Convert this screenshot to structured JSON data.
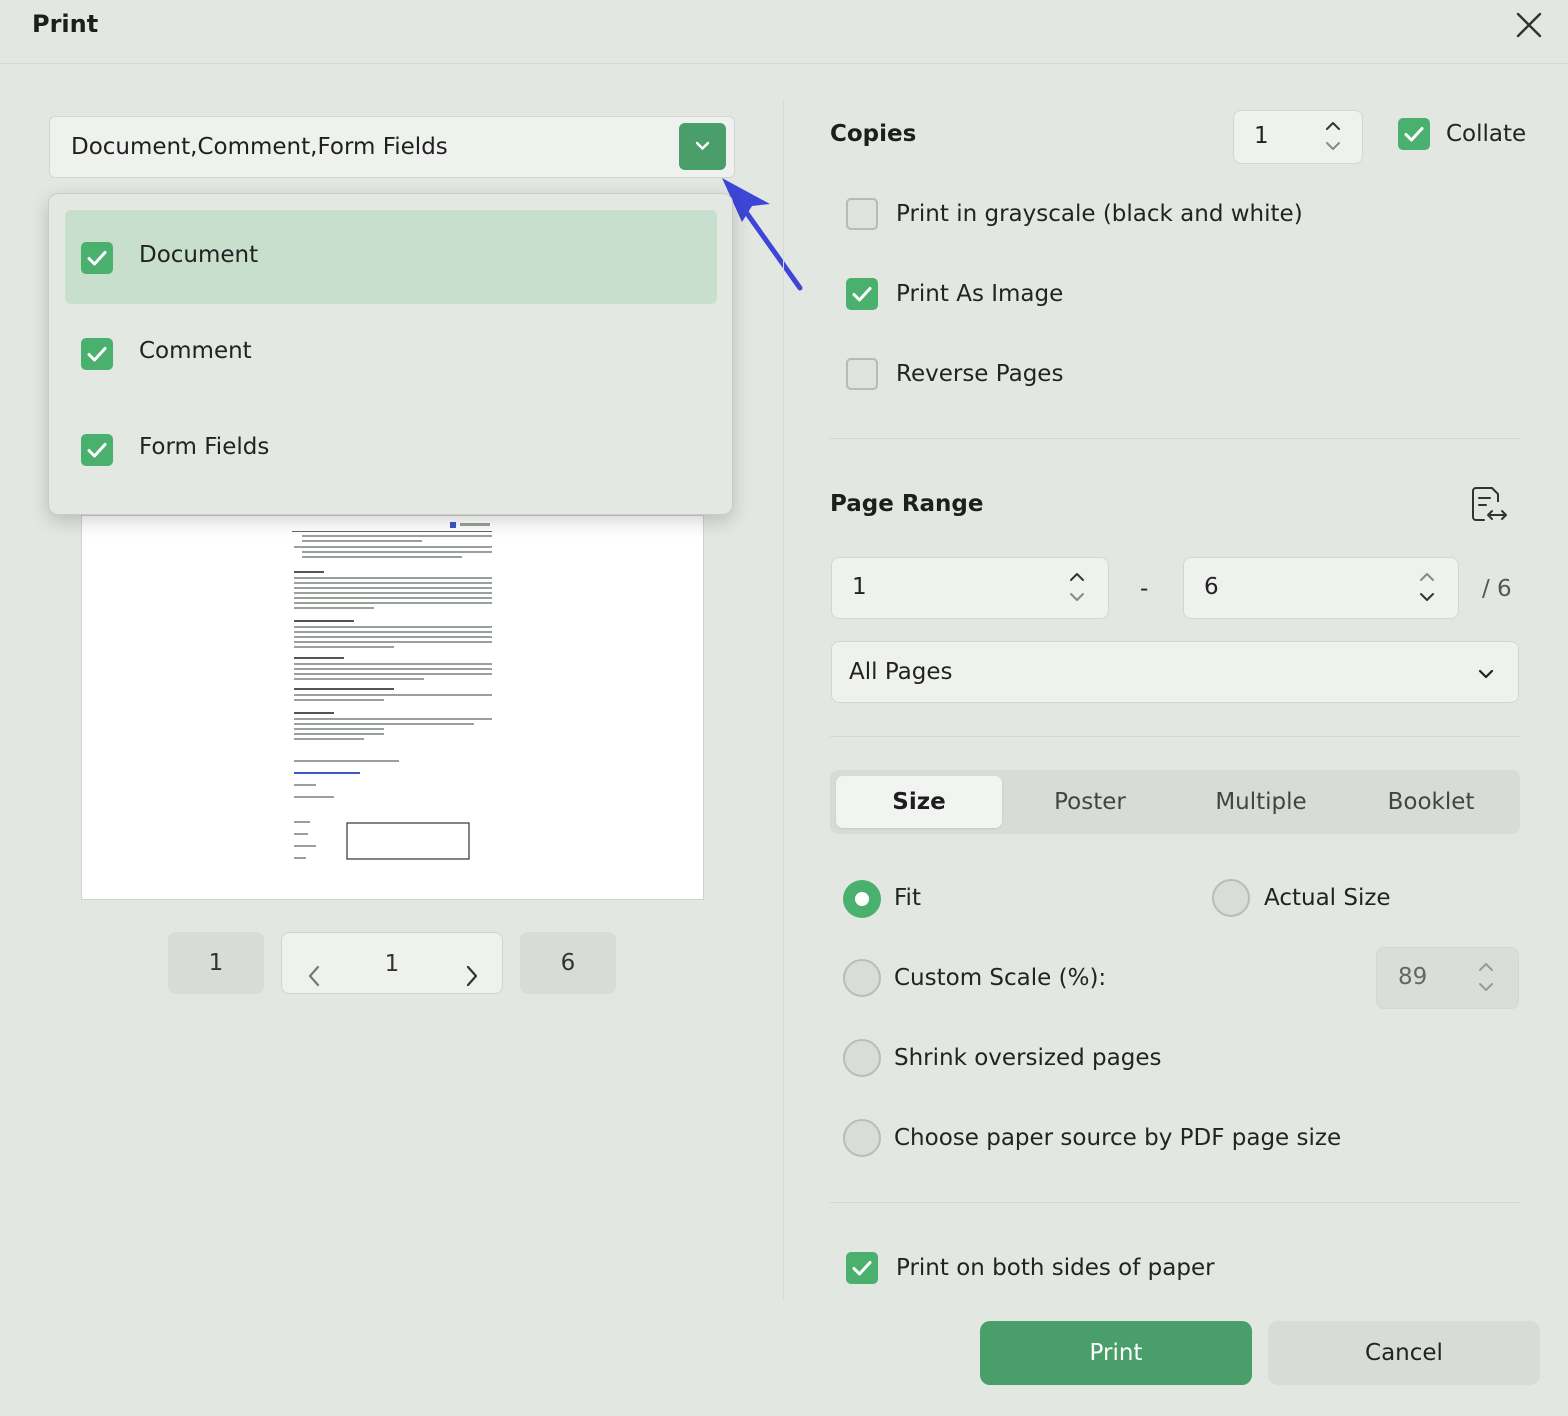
{
  "window": {
    "title": "Print"
  },
  "content_select": {
    "value": "Document,Comment,Form Fields",
    "options": [
      {
        "label": "Document",
        "checked": true,
        "highlighted": true
      },
      {
        "label": "Comment",
        "checked": true
      },
      {
        "label": "Form Fields",
        "checked": true
      }
    ]
  },
  "preview": {
    "pagination": {
      "first": "1",
      "current": "1",
      "last": "6"
    }
  },
  "copies": {
    "label": "Copies",
    "value": "1",
    "collate_label": "Collate",
    "collate_checked": true
  },
  "options": {
    "grayscale": {
      "label": "Print in grayscale (black and white)",
      "checked": false
    },
    "as_image": {
      "label": "Print As Image",
      "checked": true
    },
    "reverse": {
      "label": "Reverse Pages",
      "checked": false
    }
  },
  "page_range": {
    "label": "Page Range",
    "from": "1",
    "dash": "-",
    "to": "6",
    "total": "/ 6",
    "subset": "All Pages"
  },
  "tabs": [
    {
      "label": "Size",
      "active": true
    },
    {
      "label": "Poster"
    },
    {
      "label": "Multiple"
    },
    {
      "label": "Booklet"
    }
  ],
  "size": {
    "fit": "Fit",
    "actual": "Actual Size",
    "custom": "Custom Scale (%):",
    "custom_value": "89",
    "shrink": "Shrink oversized pages",
    "paper_source": "Choose paper source by PDF page size",
    "selected": "fit"
  },
  "duplex": {
    "label": "Print on both sides of paper",
    "checked": true
  },
  "buttons": {
    "print": "Print",
    "cancel": "Cancel"
  },
  "colors": {
    "accent": "#4a9e6a",
    "check": "#4ab06e",
    "highlight": "#c8dfcd",
    "annotation_arrow": "#3d46d6"
  }
}
